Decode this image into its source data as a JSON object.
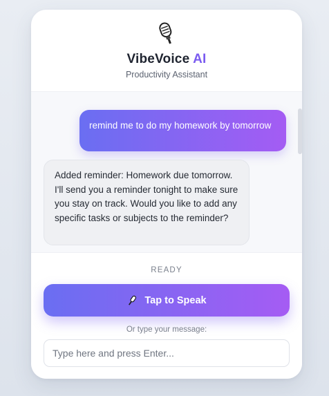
{
  "header": {
    "logo_icon": "microphone-icon",
    "title_main": "VibeVoice",
    "title_accent": "AI",
    "subtitle": "Productivity Assistant"
  },
  "chat": {
    "messages": [
      {
        "role": "user",
        "text": "remind me to do my homework by tomorrow"
      },
      {
        "role": "assistant",
        "text": "Added reminder: Homework due tomorrow. I'll send you a reminder tonight to make sure you stay on track. Would you like to add any specific tasks or subjects to the reminder?"
      }
    ]
  },
  "controls": {
    "status": "READY",
    "speak_button": {
      "icon": "microphone-icon",
      "label": "Tap to Speak"
    },
    "hint": "Or type your message:",
    "input_placeholder": "Type here and press Enter..."
  },
  "colors": {
    "accent_start": "#6a6ef2",
    "accent_end": "#a55cf3",
    "title_accent": "#7b5cf0",
    "background": "#e4e8ef"
  }
}
